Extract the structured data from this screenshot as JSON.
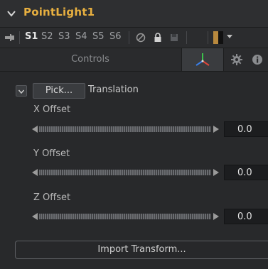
{
  "header": {
    "title": "PointLight1"
  },
  "toolbar": {
    "slots": [
      "S1",
      "S2",
      "S3",
      "S4",
      "S5",
      "S6"
    ],
    "active_slot": "S1"
  },
  "tabs": {
    "controls_label": "Controls"
  },
  "group": {
    "pick_label": "Pick...",
    "label": "Translation"
  },
  "params": [
    {
      "label": "X Offset",
      "value": "0.0"
    },
    {
      "label": "Y Offset",
      "value": "0.0"
    },
    {
      "label": "Z Offset",
      "value": "0.0"
    }
  ],
  "actions": {
    "import_transform_label": "Import Transform..."
  },
  "colors": {
    "title": "#e8b040",
    "background": "#27282a",
    "swatch_left": "#b8893e",
    "swatch_right": "#111111",
    "axis_x": "#e0463a",
    "axis_y": "#3bc24a",
    "axis_z": "#3a7ee6"
  },
  "icons": [
    "chevron-down-icon",
    "pin-icon",
    "disable-icon",
    "lock-icon",
    "save-icon",
    "color-swatch",
    "dropdown-arrow-icon",
    "transform-axes-icon",
    "gear-icon",
    "info-icon",
    "slider-left-arrow-icon",
    "slider-right-arrow-icon"
  ]
}
